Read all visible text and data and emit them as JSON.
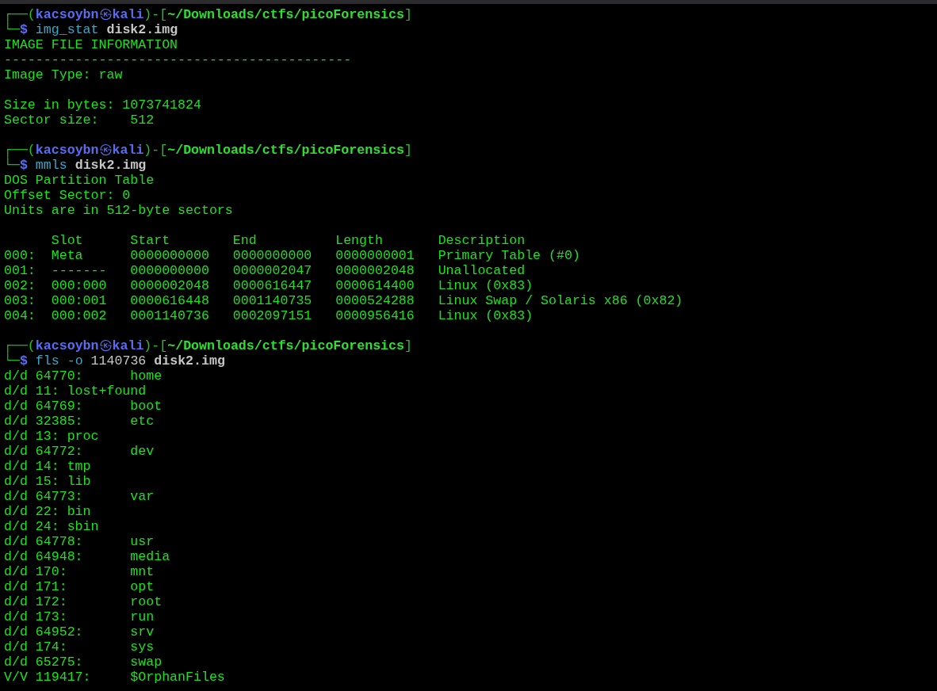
{
  "blocks": [
    {
      "prompt": {
        "open": "┌──(",
        "user": "kacsoybn",
        "at": "㉿",
        "host": "kali",
        "mid": ")-[",
        "path": "~/Downloads/ctfs/picoForensics",
        "close": "]",
        "corner": "└─",
        "symbol": "$"
      },
      "command": [
        {
          "kind": "program",
          "text": "img_stat"
        },
        {
          "kind": "file",
          "text": "disk2.img"
        }
      ],
      "output": [
        {
          "kind": "line",
          "text": "IMAGE FILE INFORMATION"
        },
        {
          "kind": "line",
          "text": "--------------------------------------------"
        },
        {
          "kind": "line",
          "text": "Image Type: raw"
        },
        {
          "kind": "blank"
        },
        {
          "kind": "line",
          "text": "Size in bytes: 1073741824"
        },
        {
          "kind": "line",
          "text": "Sector size:    512"
        },
        {
          "kind": "blank"
        }
      ]
    },
    {
      "prompt": {
        "open": "┌──(",
        "user": "kacsoybn",
        "at": "㉿",
        "host": "kali",
        "mid": ")-[",
        "path": "~/Downloads/ctfs/picoForensics",
        "close": "]",
        "corner": "└─",
        "symbol": "$"
      },
      "command": [
        {
          "kind": "program",
          "text": "mmls"
        },
        {
          "kind": "file",
          "text": "disk2.img"
        }
      ],
      "output": [
        {
          "kind": "line",
          "text": "DOS Partition Table"
        },
        {
          "kind": "line",
          "text": "Offset Sector: 0"
        },
        {
          "kind": "line",
          "text": "Units are in 512-byte sectors"
        },
        {
          "kind": "blank"
        },
        {
          "kind": "table",
          "columns": [
            "",
            "Slot",
            "Start",
            "End",
            "Length",
            "Description"
          ],
          "rows": [
            [
              "000:",
              "Meta",
              "0000000000",
              "0000000000",
              "0000000001",
              "Primary Table (#0)"
            ],
            [
              "001:",
              "-------",
              "0000000000",
              "0000002047",
              "0000002048",
              "Unallocated"
            ],
            [
              "002:",
              "000:000",
              "0000002048",
              "0000616447",
              "0000614400",
              "Linux (0x83)"
            ],
            [
              "003:",
              "000:001",
              "0000616448",
              "0001140735",
              "0000524288",
              "Linux Swap / Solaris x86 (0x82)"
            ],
            [
              "004:",
              "000:002",
              "0001140736",
              "0002097151",
              "0000956416",
              "Linux (0x83)"
            ]
          ]
        },
        {
          "kind": "blank"
        }
      ]
    },
    {
      "prompt": {
        "open": "┌──(",
        "user": "kacsoybn",
        "at": "㉿",
        "host": "kali",
        "mid": ")-[",
        "path": "~/Downloads/ctfs/picoForensics",
        "close": "]",
        "corner": "└─",
        "symbol": "$"
      },
      "command": [
        {
          "kind": "program",
          "text": "fls"
        },
        {
          "kind": "option",
          "text": "-o"
        },
        {
          "kind": "number",
          "text": "1140736"
        },
        {
          "kind": "file",
          "text": "disk2.img"
        }
      ],
      "output": [
        {
          "kind": "line",
          "text": "d/d 64770:      home"
        },
        {
          "kind": "line",
          "text": "d/d 11: lost+found"
        },
        {
          "kind": "line",
          "text": "d/d 64769:      boot"
        },
        {
          "kind": "line",
          "text": "d/d 32385:      etc"
        },
        {
          "kind": "line",
          "text": "d/d 13: proc"
        },
        {
          "kind": "line",
          "text": "d/d 64772:      dev"
        },
        {
          "kind": "line",
          "text": "d/d 14: tmp"
        },
        {
          "kind": "line",
          "text": "d/d 15: lib"
        },
        {
          "kind": "line",
          "text": "d/d 64773:      var"
        },
        {
          "kind": "line",
          "text": "d/d 22: bin"
        },
        {
          "kind": "line",
          "text": "d/d 24: sbin"
        },
        {
          "kind": "line",
          "text": "d/d 64778:      usr"
        },
        {
          "kind": "line",
          "text": "d/d 64948:      media"
        },
        {
          "kind": "line",
          "text": "d/d 170:        mnt"
        },
        {
          "kind": "line",
          "text": "d/d 171:        opt"
        },
        {
          "kind": "line",
          "text": "d/d 172:        root"
        },
        {
          "kind": "line",
          "text": "d/d 173:        run"
        },
        {
          "kind": "line",
          "text": "d/d 64952:      srv"
        },
        {
          "kind": "line",
          "text": "d/d 174:        sys"
        },
        {
          "kind": "line",
          "text": "d/d 65275:      swap"
        },
        {
          "kind": "line",
          "text": "V/V 119417:     $OrphanFiles"
        }
      ]
    }
  ]
}
